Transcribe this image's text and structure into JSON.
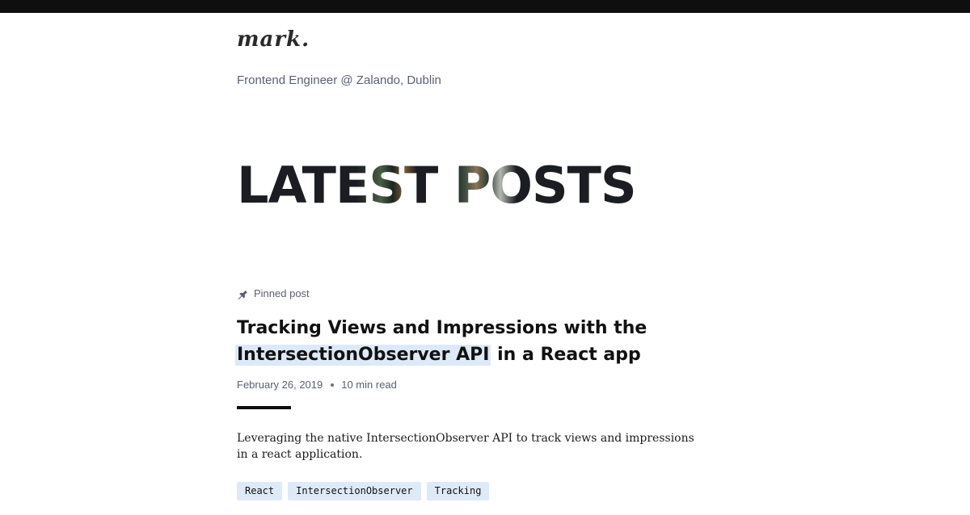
{
  "site": {
    "logo_text": "mark.",
    "tagline": "Frontend Engineer @ Zalando, Dublin"
  },
  "section": {
    "title": "LATEST POSTS"
  },
  "post": {
    "pinned_label": "Pinned post",
    "title_line1": "Tracking Views and Impressions with the",
    "title_highlight": "IntersectionObserver API",
    "title_rest": "in a React app",
    "date": "February 26, 2019",
    "read_time": "10 min read",
    "excerpt": "Leveraging the native IntersectionObserver API to track views and impressions in a react application.",
    "tags": [
      "React",
      "IntersectionObserver",
      "Tracking"
    ]
  },
  "colors": {
    "top_bar": "#0f0f0f",
    "muted_text": "#5b5f73",
    "highlight": "#dde9f8",
    "tag_bg": "#dfeaf8"
  },
  "icons": {
    "pin": "pin-icon"
  }
}
